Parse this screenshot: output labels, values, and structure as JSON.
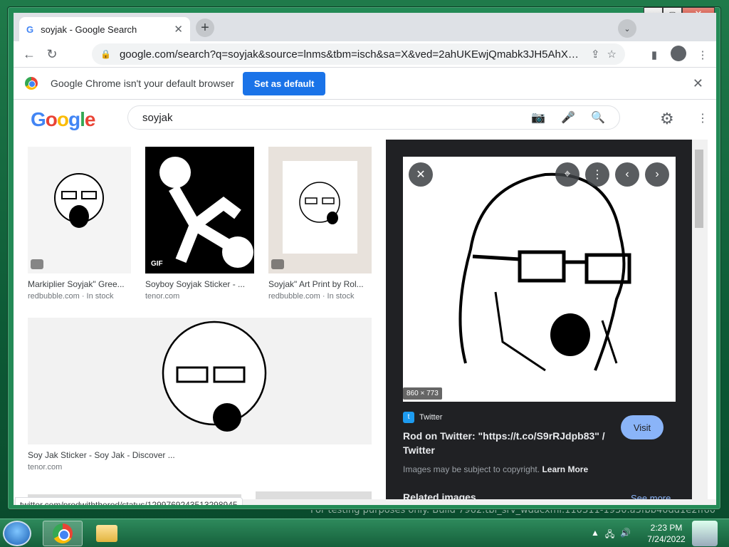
{
  "browser": {
    "tab_title": "soyjak - Google Search",
    "tab_favicon": "G",
    "url": "google.com/search?q=soyjak&source=lnms&tbm=isch&sa=X&ved=2ahUKEwjQmabk3JH5AhXDmIkEHdw..."
  },
  "infobar": {
    "message": "Google Chrome isn't your default browser",
    "button": "Set as default"
  },
  "search": {
    "query": "soyjak"
  },
  "results": [
    {
      "title": "Markiplier Soyjak\" Gree...",
      "source": "redbubble.com · In stock",
      "badge": "tag"
    },
    {
      "title": "Soyboy Soyjak Sticker - ...",
      "source": "tenor.com",
      "badge": "GIF"
    },
    {
      "title": "Soyjak\" Art Print by Rol...",
      "source": "redbubble.com · In stock",
      "badge": "tag"
    },
    {
      "title": "Soy Jak Sticker - Soy Jak - Discover ...",
      "source": "tenor.com",
      "badge": ""
    }
  ],
  "preview": {
    "dimensions": "860 × 773",
    "source": "Twitter",
    "title": "Rod on Twitter: \"https://t.co/S9rRJdpb83\" / Twitter",
    "visit": "Visit",
    "copyright": "Images may be subject to copyright.",
    "learn_more": "Learn More",
    "related": "Related images",
    "see_more": "See more"
  },
  "status_url": "twitter.com/prodwiththerod/status/1299769243513298945",
  "watermark": "For testing purposes only. Build 7962.tbl_srv_wdacxml.110311-1930.a3fbb40dd1e2ff60",
  "taskbar": {
    "time": "2:23 PM",
    "date": "7/24/2022"
  }
}
